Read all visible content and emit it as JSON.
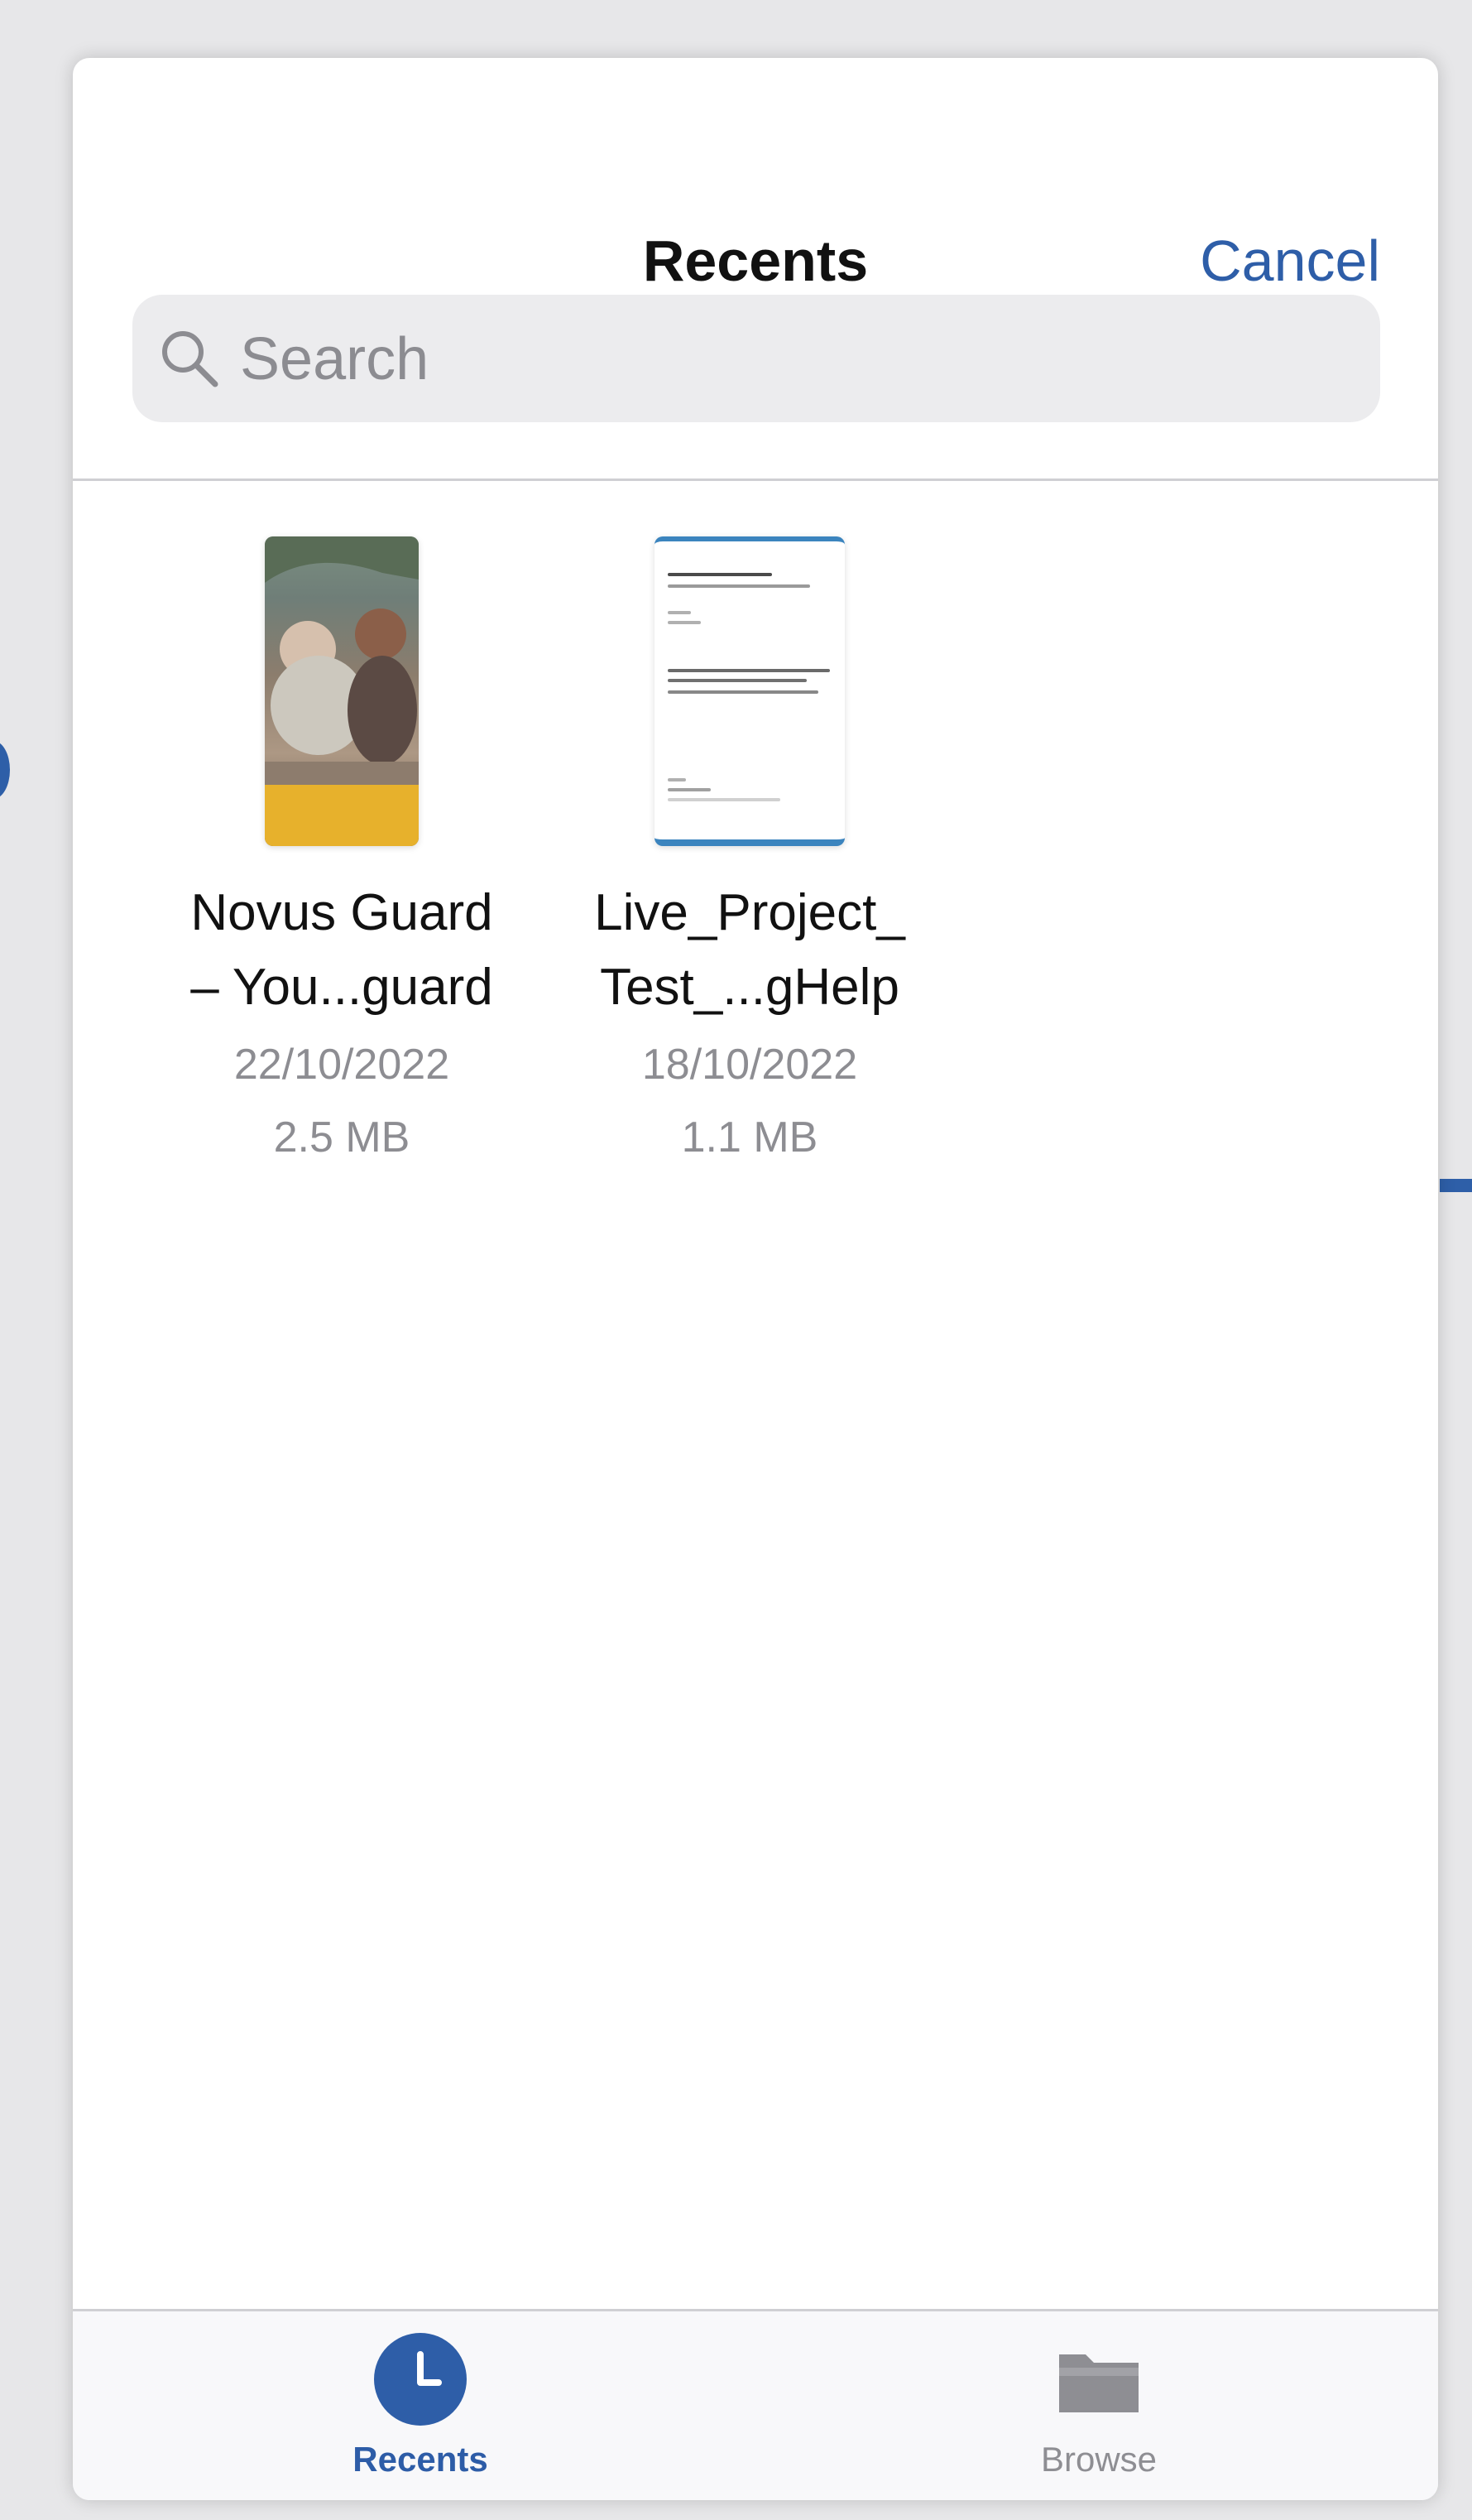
{
  "header": {
    "title": "Recents",
    "cancel_label": "Cancel"
  },
  "search": {
    "placeholder": "Search",
    "value": ""
  },
  "files": [
    {
      "name": "Novus Guard\n– You...guard",
      "date": "22/10/2022",
      "size": "2.5 MB",
      "thumbnail": "photo-document"
    },
    {
      "name": "Live_Project_\nTest_...gHelp",
      "date": "18/10/2022",
      "size": "1.1 MB",
      "thumbnail": "text-document"
    }
  ],
  "tabbar": {
    "recents_label": "Recents",
    "browse_label": "Browse",
    "active_tab": "Recents"
  },
  "colors": {
    "accent": "#2e5ea8",
    "search_bg": "#ececee",
    "muted_text": "#8d8d92",
    "folder_icon": "#8e8e93"
  }
}
